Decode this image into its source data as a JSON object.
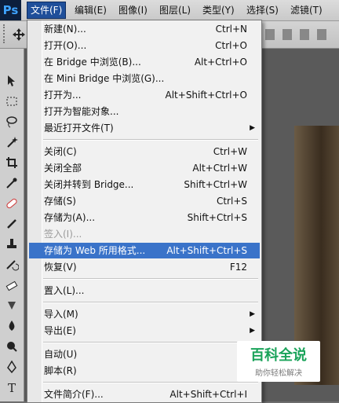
{
  "app": {
    "logo": "Ps"
  },
  "menubar": {
    "items": [
      {
        "label": "文件(F)",
        "active": true
      },
      {
        "label": "编辑(E)"
      },
      {
        "label": "图像(I)"
      },
      {
        "label": "图层(L)"
      },
      {
        "label": "类型(Y)"
      },
      {
        "label": "选择(S)"
      },
      {
        "label": "滤镜(T)"
      }
    ]
  },
  "file_menu": {
    "items": [
      {
        "label": "新建(N)...",
        "shortcut": "Ctrl+N"
      },
      {
        "label": "打开(O)...",
        "shortcut": "Ctrl+O"
      },
      {
        "label": "在 Bridge 中浏览(B)...",
        "shortcut": "Alt+Ctrl+O"
      },
      {
        "label": "在 Mini Bridge 中浏览(G)...",
        "shortcut": ""
      },
      {
        "label": "打开为...",
        "shortcut": "Alt+Shift+Ctrl+O"
      },
      {
        "label": "打开为智能对象...",
        "shortcut": ""
      },
      {
        "label": "最近打开文件(T)",
        "shortcut": "",
        "submenu": true
      },
      {
        "label": "关闭(C)",
        "shortcut": "Ctrl+W"
      },
      {
        "label": "关闭全部",
        "shortcut": "Alt+Ctrl+W"
      },
      {
        "label": "关闭并转到 Bridge...",
        "shortcut": "Shift+Ctrl+W"
      },
      {
        "label": "存储(S)",
        "shortcut": "Ctrl+S"
      },
      {
        "label": "存储为(A)...",
        "shortcut": "Shift+Ctrl+S"
      },
      {
        "label": "签入(I)...",
        "shortcut": "",
        "disabled": true
      },
      {
        "label": "存储为 Web 所用格式...",
        "shortcut": "Alt+Shift+Ctrl+S",
        "highlighted": true
      },
      {
        "label": "恢复(V)",
        "shortcut": "F12"
      },
      {
        "label": "置入(L)...",
        "shortcut": ""
      },
      {
        "label": "导入(M)",
        "shortcut": "",
        "submenu": true
      },
      {
        "label": "导出(E)",
        "shortcut": "",
        "submenu": true
      },
      {
        "label": "自动(U)",
        "shortcut": ""
      },
      {
        "label": "脚本(R)",
        "shortcut": ""
      },
      {
        "label": "文件简介(F)...",
        "shortcut": "Alt+Shift+Ctrl+I"
      }
    ],
    "submenu_glyph": "▶"
  },
  "watermark": {
    "title": "百科全说",
    "subtitle": "助你轻松解决"
  },
  "colors": {
    "highlight": "#3a73c9",
    "menubar_active": "#1f4f9a",
    "watermark_green": "#1aa35a"
  },
  "toolbox_icons": [
    "move-icon",
    "marquee-icon",
    "lasso-icon",
    "magic-wand-icon",
    "crop-icon",
    "eyedropper-icon",
    "healing-brush-icon",
    "brush-icon",
    "clone-stamp-icon",
    "history-brush-icon",
    "eraser-icon",
    "gradient-icon",
    "blur-icon",
    "dodge-icon",
    "pen-icon",
    "type-icon"
  ]
}
